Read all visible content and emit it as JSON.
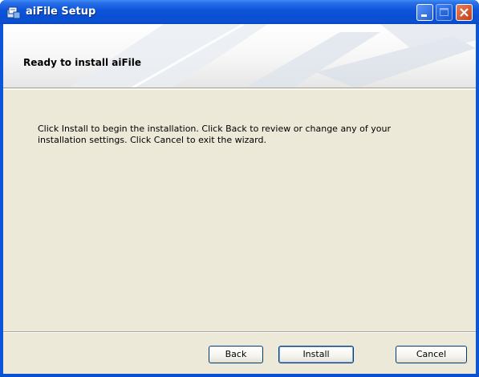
{
  "window": {
    "title": "aiFile Setup",
    "controls": {
      "minimize_icon": "minimize-icon",
      "maximize_icon": "maximize-icon",
      "close_icon": "close-icon"
    }
  },
  "banner": {
    "title": "Ready to install aiFile"
  },
  "body": {
    "description": "Click Install to begin the installation. Click Back to review or change any of your installation settings. Click Cancel to exit the wizard."
  },
  "buttons": {
    "back": "Back",
    "install": "Install",
    "cancel": "Cancel"
  },
  "colors": {
    "titlebar": "#0a55d8",
    "dialog_background": "#ece9d8",
    "close_button": "#c23e17"
  }
}
